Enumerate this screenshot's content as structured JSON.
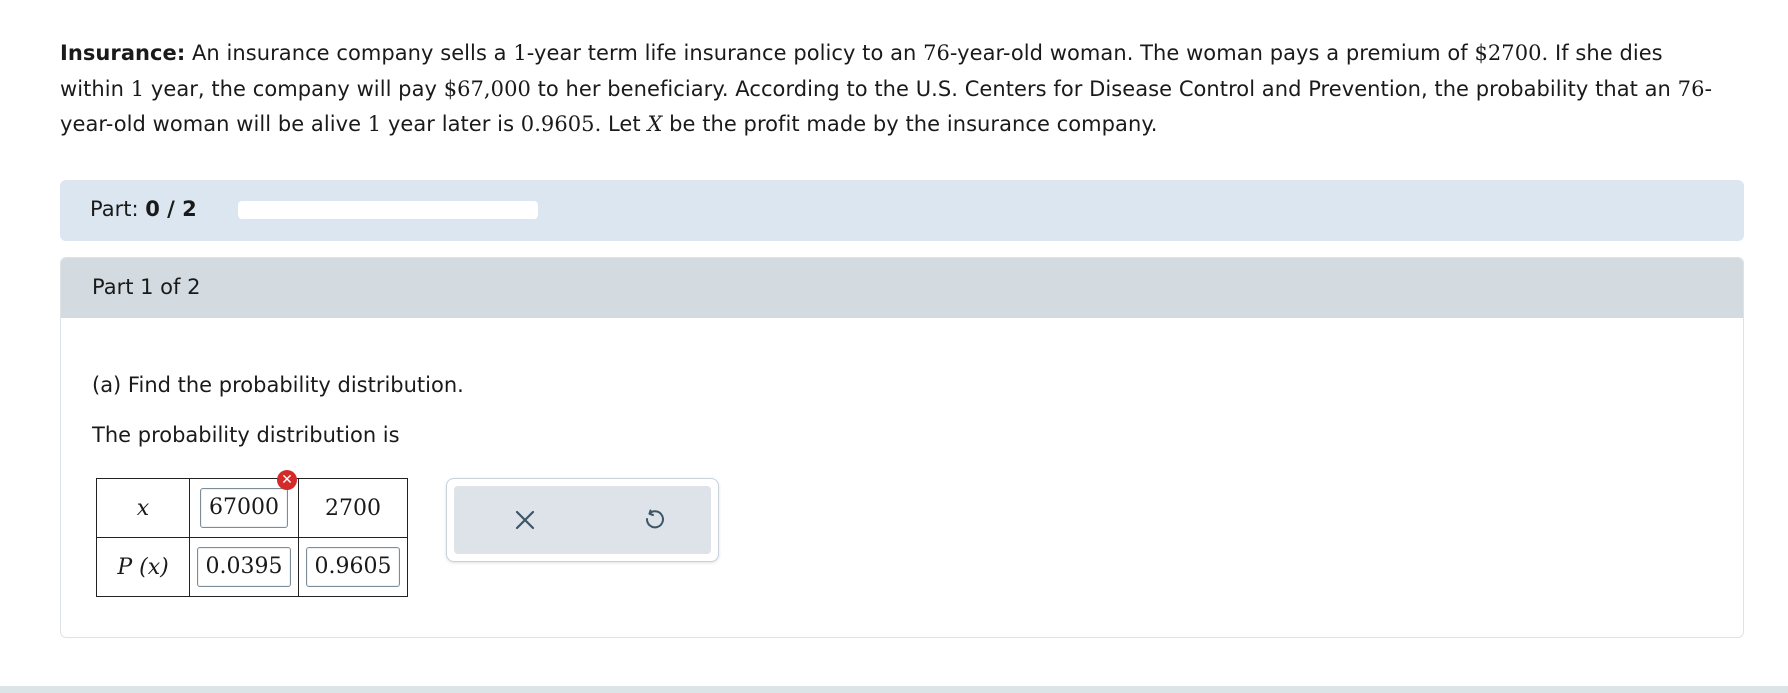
{
  "problem": {
    "title": "Insurance:",
    "t1": " An insurance company sells a ",
    "m1": "1",
    "t2": "-year term life insurance policy to an ",
    "m2": "76",
    "t3": "-year-old woman. The woman pays a premium of ",
    "m3": "$2700.",
    "t4": " If she dies within ",
    "m4": "1",
    "t5": " year, the company will pay ",
    "m5": "$67,000",
    "t6": " to her beneficiary. According to the U.S. Centers for Disease Control and Prevention, the probability that an ",
    "m6": "76",
    "t7": "-year-old woman will be alive ",
    "m7": "1",
    "t8": " year later is ",
    "m8": "0.9605.",
    "t9": " Let ",
    "m9": "X",
    "t10": " be the profit made by the insurance company."
  },
  "progress": {
    "label": "Part:",
    "value": "0 / 2",
    "fraction": 0
  },
  "part": {
    "header": "Part 1 of 2",
    "question": "(a) Find the probability distribution.",
    "intro": "The probability distribution is"
  },
  "table": {
    "x_label": "x",
    "px_label": "P (x)",
    "x_values": [
      "67000",
      "2700"
    ],
    "px_values": [
      "0.0395",
      "0.9605"
    ],
    "error_mark": "✕"
  },
  "actions": {
    "clear_icon": "close-icon",
    "reset_icon": "undo-icon",
    "icon_color": "#3d5566"
  },
  "colors": {
    "progress_bg": "#dce6f0",
    "header_bg": "#d3dbe0",
    "error": "#d42a2a"
  }
}
